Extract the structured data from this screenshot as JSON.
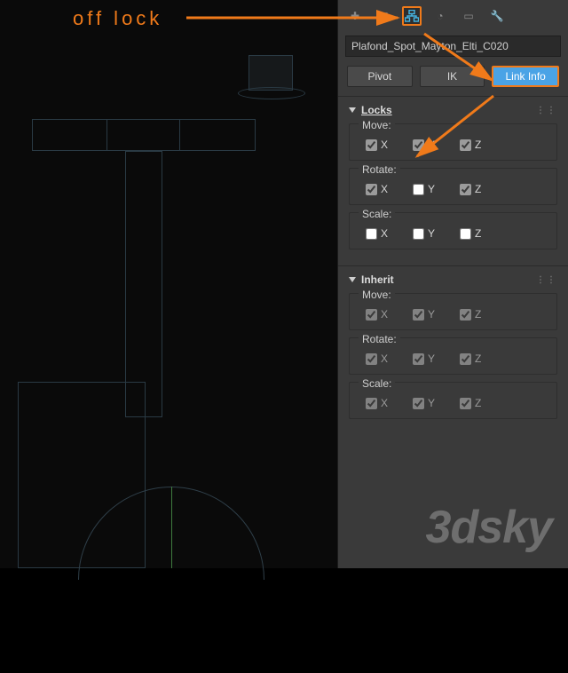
{
  "annotation": {
    "label": "off lock"
  },
  "panel": {
    "object_name": "Plafond_Spot_Mayton_Elti_C020",
    "tabs": {
      "pivot": "Pivot",
      "ik": "IK",
      "link_info": "Link Info"
    },
    "rollups": {
      "locks": {
        "title": "Locks",
        "move": {
          "label": "Move:",
          "x": true,
          "y": true,
          "z": true
        },
        "rotate": {
          "label": "Rotate:",
          "x": true,
          "y": false,
          "z": true
        },
        "scale": {
          "label": "Scale:",
          "x": false,
          "y": false,
          "z": false
        }
      },
      "inherit": {
        "title": "Inherit",
        "move": {
          "label": "Move:",
          "x": true,
          "y": true,
          "z": true
        },
        "rotate": {
          "label": "Rotate:",
          "x": true,
          "y": true,
          "z": true
        },
        "scale": {
          "label": "Scale:",
          "x": true,
          "y": true,
          "z": true
        }
      }
    },
    "axis": {
      "x": "X",
      "y": "Y",
      "z": "Z"
    }
  },
  "watermark": "3dsky"
}
